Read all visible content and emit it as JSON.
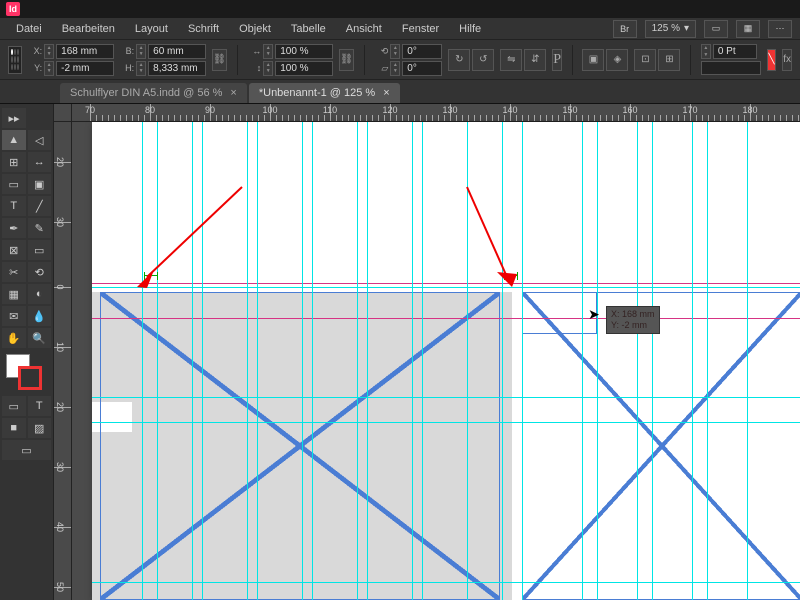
{
  "app_icon": "Id",
  "menu": [
    "Datei",
    "Bearbeiten",
    "Layout",
    "Schrift",
    "Objekt",
    "Tabelle",
    "Ansicht",
    "Fenster",
    "Hilfe"
  ],
  "menu_right": {
    "br": "Br",
    "zoom": "125 %"
  },
  "controls": {
    "x": "168 mm",
    "y": "-2 mm",
    "w": "60 mm",
    "h": "8,333 mm",
    "scale_x": "100 %",
    "scale_y": "100 %",
    "rotate": "0°",
    "shear": "0°",
    "stroke": "0 Pt"
  },
  "tabs": [
    {
      "label": "Schulflyer DIN A5.indd @ 56 %",
      "active": false
    },
    {
      "label": "*Unbenannt-1 @ 125 %",
      "active": true
    }
  ],
  "ruler_h": [
    70,
    80,
    90,
    100,
    110,
    120,
    130,
    140,
    150,
    160,
    170,
    180
  ],
  "ruler_v": [
    20,
    30,
    40,
    0
  ],
  "tooltip": {
    "x": "X: 168 mm",
    "y": "Y: -2 mm"
  }
}
